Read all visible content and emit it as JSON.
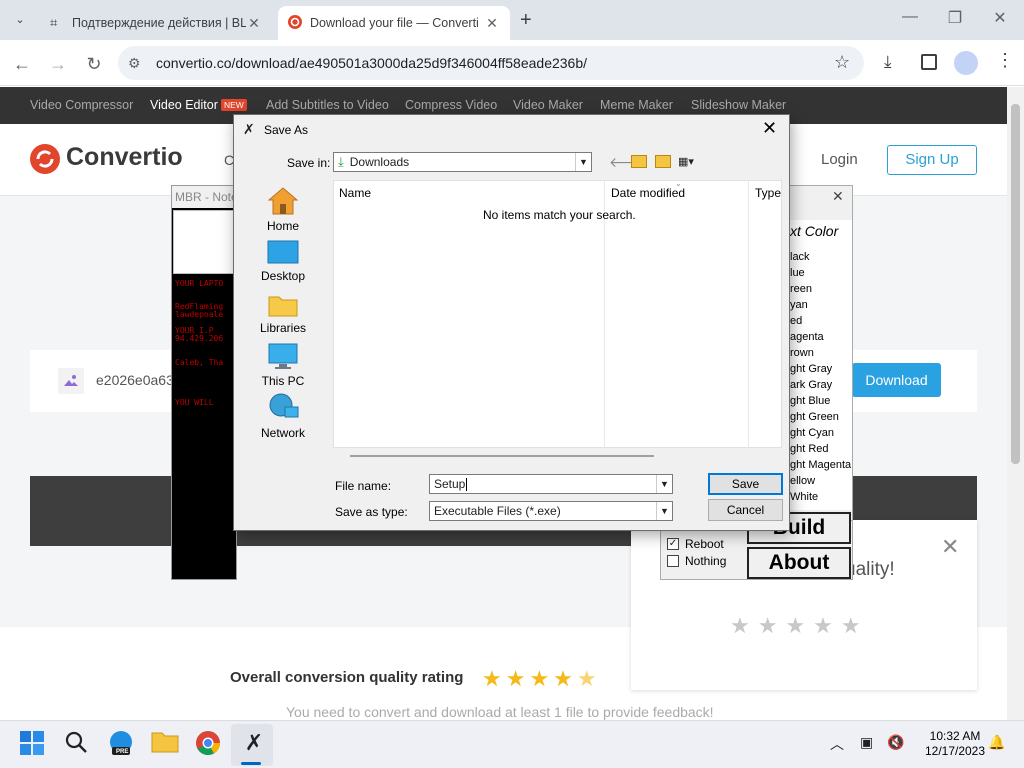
{
  "browser": {
    "tabs": [
      {
        "title": "Подтверждение действия | BL"
      },
      {
        "title": "Download your file — Converti"
      }
    ],
    "url": "convertio.co/download/ae490501a3000da25d9f346004ff58eade236b/"
  },
  "site": {
    "topnav": [
      "Video Compressor",
      "Video Editor",
      "Add Subtitles to Video",
      "Compress Video",
      "Video Maker",
      "Meme Maker",
      "Slideshow Maker"
    ],
    "new_badge": "NEW",
    "logo": "Convertio",
    "login": "Login",
    "signup": "Sign Up",
    "file_name_partial": "e2026e0a63",
    "download_label": "Download",
    "quality_text": "uality!",
    "rating_label": "Overall conversion quality rating",
    "feedback_text": "You need to convert and download at least 1 file to provide feedback!"
  },
  "notepad": {
    "title": "MBR - Note",
    "lines": [
      "YOUR LAPTO",
      "RedFlaming",
      "lawdepoale",
      "YOUR I.P",
      "94.429.206",
      "Caleb, Tha",
      "YOU WILL"
    ]
  },
  "color_panel": {
    "title": "xt Color",
    "colors": [
      "lack",
      "lue",
      "reen",
      "yan",
      "ed",
      "agenta",
      "rown",
      "ght Gray",
      "ark Gray",
      "ght Blue",
      "ght Green",
      "ght Cyan",
      "ght Red",
      "ght Magenta",
      "ellow",
      "White"
    ],
    "build": "Build",
    "about": "About",
    "reboot": "Reboot",
    "nothing": "Nothing"
  },
  "dialog": {
    "title": "Save As",
    "save_in_label": "Save in:",
    "save_in_value": "Downloads",
    "places": [
      "Home",
      "Desktop",
      "Libraries",
      "This PC",
      "Network"
    ],
    "columns": [
      "Name",
      "Date modified",
      "Type"
    ],
    "empty_message": "No items match your search.",
    "file_name_label": "File name:",
    "file_name_value": "Setup",
    "save_type_label": "Save as type:",
    "save_type_value": "Executable Files (*.exe)",
    "save_button": "Save",
    "cancel_button": "Cancel"
  },
  "taskbar": {
    "time": "10:32 AM",
    "date": "12/17/2023",
    "edge_badge": "PRE"
  },
  "colors": {
    "convertio_red": "#e1452c",
    "convertio_blue": "#2aa1e0",
    "star": "#f6b91a",
    "dialog_focus": "#0078d7"
  }
}
